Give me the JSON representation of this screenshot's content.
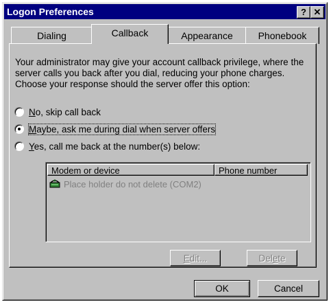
{
  "window": {
    "title": "Logon Preferences",
    "help_label": "?",
    "close_label": "✕"
  },
  "tabs": [
    {
      "label": "Dialing"
    },
    {
      "label": "Callback"
    },
    {
      "label": "Appearance"
    },
    {
      "label": "Phonebook"
    }
  ],
  "description": "Your administrator may give your account callback privilege, where the server calls you back after you dial, reducing your phone charges.  Choose your response should the server offer this option:",
  "options": [
    {
      "label_pre": "",
      "mnemonic": "N",
      "label_post": "o, skip call back",
      "selected": false
    },
    {
      "label_pre": "",
      "mnemonic": "M",
      "label_post": "aybe, ask me during dial when server offers",
      "selected": true
    },
    {
      "label_pre": "",
      "mnemonic": "Y",
      "label_post": "es, call me back at the number(s) below:",
      "selected": false
    }
  ],
  "list": {
    "columns": [
      "Modem or device",
      "Phone number"
    ],
    "rows": [
      {
        "device": "Place holder do not delete (COM2)",
        "phone": "",
        "icon": "modem-icon"
      }
    ]
  },
  "buttons": {
    "edit_pre": "",
    "edit_mnemonic": "E",
    "edit_post": "dit...",
    "delete_pre": "Del",
    "delete_mnemonic": "e",
    "delete_post": "te",
    "ok": "OK",
    "cancel": "Cancel"
  }
}
